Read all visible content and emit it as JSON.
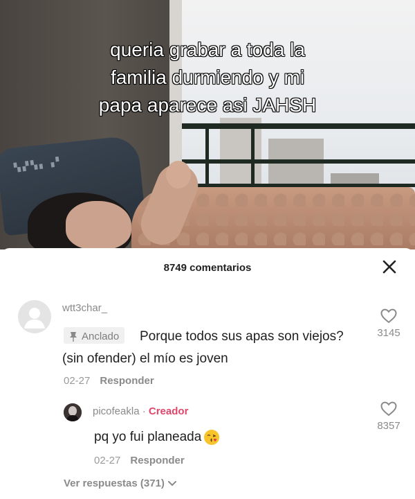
{
  "video": {
    "caption_lines": [
      "queria grabar a toda la",
      "familia durmiendo y mi",
      "papa aparece asi JAHSH"
    ]
  },
  "comments_header": {
    "title": "8749 comentarios"
  },
  "comment": {
    "username": "wtt3char_",
    "pinned_label": "Anclado",
    "text": "Porque todos sus apas son viejos?(sin ofender) el mío es joven",
    "date": "02-27",
    "reply_label": "Responder",
    "likes": "3145"
  },
  "reply": {
    "username": "picofeakla",
    "separator": "·",
    "creator_label": "Creador",
    "text": "pq yo fui planeada",
    "date": "02-27",
    "reply_label": "Responder",
    "likes": "8357"
  },
  "view_replies": {
    "label": "Ver respuestas (371)"
  },
  "icons": {
    "close": "close-icon",
    "pin": "pin-icon",
    "heart": "heart-outline-icon",
    "chevron": "chevron-down-icon",
    "emoji": "kissing-face-emoji"
  },
  "colors": {
    "creator_accent": "#e0456a",
    "muted_text": "#8a8a8a",
    "body_text": "#1f1f1f"
  }
}
